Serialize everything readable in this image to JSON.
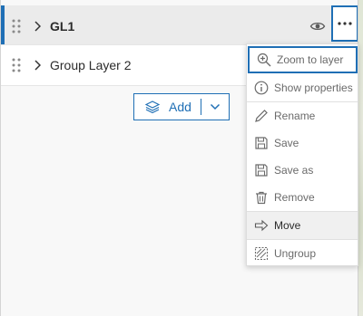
{
  "layers": [
    {
      "title": "GL1",
      "selected": true
    },
    {
      "title": "Group Layer 2",
      "selected": false
    }
  ],
  "icons": {
    "drag": "grip-dots-icon",
    "expand": "chevron-right-icon",
    "visibility": "eye-icon",
    "options": "ellipsis-icon",
    "add": "layers-stack-icon",
    "dropdown": "chevron-down-icon"
  },
  "add_button": {
    "label": "Add"
  },
  "context_menu": {
    "items": [
      {
        "label": "Zoom to layer",
        "icon": "zoom-in-icon"
      },
      {
        "label": "Show properties",
        "icon": "info-icon"
      },
      {
        "label": "Rename",
        "icon": "pencil-icon"
      },
      {
        "label": "Save",
        "icon": "save-icon"
      },
      {
        "label": "Save as",
        "icon": "save-as-icon"
      },
      {
        "label": "Remove",
        "icon": "trash-icon"
      },
      {
        "label": "Move",
        "icon": "arrow-right-icon"
      },
      {
        "label": "Ungroup",
        "icon": "ungroup-icon"
      }
    ]
  },
  "colors": {
    "accent": "#1f6fb5",
    "selected_row": "#ebebeb",
    "menu_hover": "#f0f0f0"
  }
}
